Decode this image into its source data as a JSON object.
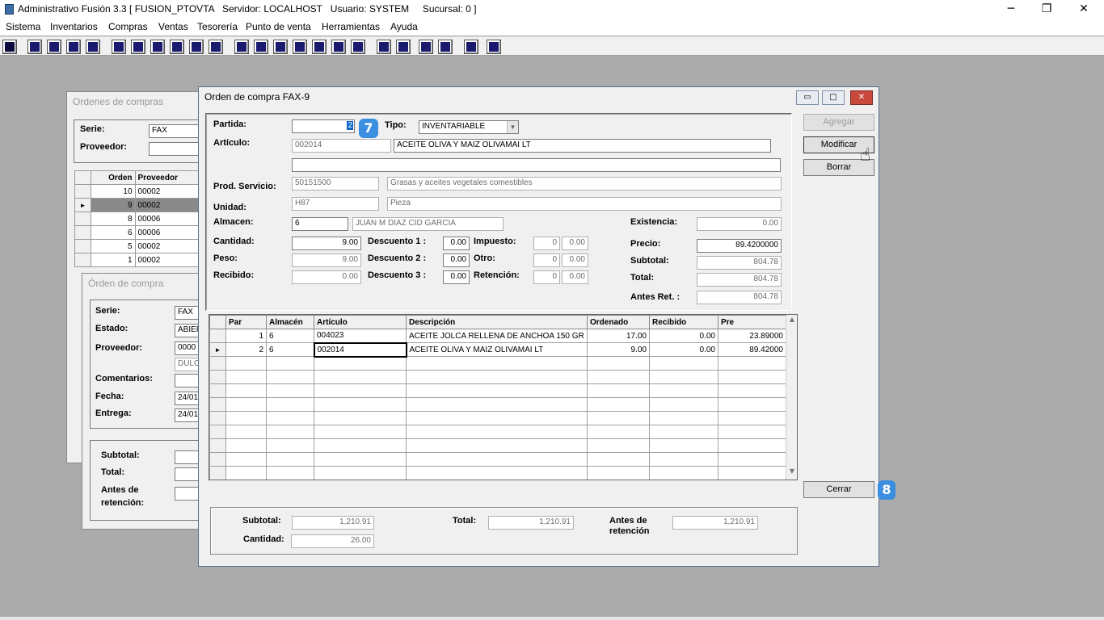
{
  "app": {
    "title": "Administrativo Fusión 3.3 [ FUSION_PTOVTA   Servidor: LOCALHOST   Usuario: SYSTEM     Sucursal: 0 ]",
    "minimize": "─",
    "restore": "❐",
    "close": "✕"
  },
  "menu": [
    "Sistema",
    "Inventarios",
    "Compras",
    "Ventas",
    "Tesorería",
    "Punto de venta",
    "Herramientas",
    "Ayuda"
  ],
  "toolbar": {
    "icons": [
      "calculator-icon",
      "copy-icon",
      "clipboard-icon",
      "swap-icon",
      "search-icon",
      "user-icon",
      "folder-icon",
      "print-icon",
      "printer-icon",
      "document-icon",
      "list-icon",
      "group-icon",
      "card-icon",
      "export-icon",
      "add-icon",
      "dollar-icon",
      "report-icon",
      "table-icon",
      "home-icon",
      "find-icon",
      "refresh-icon",
      "undo-icon",
      "back-icon",
      "help-icon"
    ]
  },
  "ordenes_window": {
    "title": "Ordenes de compras",
    "serie_label": "Serie:",
    "serie_value": "FAX",
    "proveedor_label": "Proveedor:",
    "headers": [
      "Orden",
      "Proveedor"
    ],
    "rows": [
      {
        "orden": "10",
        "prov": "00002"
      },
      {
        "orden": "9",
        "prov": "00002"
      },
      {
        "orden": "8",
        "prov": "00006"
      },
      {
        "orden": "6",
        "prov": "00006"
      },
      {
        "orden": "5",
        "prov": "00002"
      },
      {
        "orden": "1",
        "prov": "00002"
      }
    ]
  },
  "orden_window": {
    "title": "Órden de compra",
    "serie_label": "Serie:",
    "serie_value": "FAX",
    "estado_label": "Estado:",
    "estado_value": "ABIER",
    "proveedor_label": "Proveedor:",
    "proveedor_value": "0000",
    "proveedor_name": "DULC",
    "comentarios_label": "Comentarios:",
    "fecha_label": "Fecha:",
    "fecha_value": "24/01",
    "entrega_label": "Entrega:",
    "entrega_value": "24/01",
    "subtotal_label": "Subtotal:",
    "total_label": "Total:",
    "antes_label": "Antes de retención:"
  },
  "main": {
    "title": "Orden de compra FAX-9",
    "partida_label": "Partida:",
    "partida_value": "2",
    "tipo_label": "Tipo:",
    "tipo_value": "INVENTARIABLE",
    "articulo_label": "Artículo:",
    "articulo_code": "002014",
    "articulo_desc": "ACEITE OLIVA Y MAIZ OLIVAMAI LT",
    "prod_label": "Prod. Servicio:",
    "prod_code": "50151500",
    "prod_desc": "Grasas y aceites vegetales comestibles",
    "unidad_label": "Unidad:",
    "unidad_code": "H87",
    "unidad_desc": "Pieza",
    "almacen_label": "Almacen:",
    "almacen_code": "6",
    "almacen_desc": "JUAN M DIAZ CID GARCIA",
    "existencia_label": "Existencia:",
    "existencia_value": "0.00",
    "cantidad_label": "Cantidad:",
    "cantidad_value": "9.00",
    "peso_label": "Peso:",
    "peso_value": "9.00",
    "recibido_label": "Recibido:",
    "recibido_value": "0.00",
    "desc1_label": "Descuento 1 :",
    "desc1_value": "0.00",
    "desc2_label": "Descuento 2 :",
    "desc2_value": "0.00",
    "desc3_label": "Descuento 3 :",
    "desc3_value": "0.00",
    "impuesto_label": "Impuesto:",
    "impuesto_a": "0",
    "impuesto_b": "0.00",
    "otro_label": "Otro:",
    "otro_a": "0",
    "otro_b": "0.00",
    "retencion_label": "Retención:",
    "retencion_a": "0",
    "retencion_b": "0.00",
    "precio_label": "Precio:",
    "precio_value": "89.4200000",
    "subtotal_label": "Subtotal:",
    "subtotal_value": "804.78",
    "total_label": "Total:",
    "total_value": "804.78",
    "antes_label": "Antes Ret. :",
    "antes_value": "804.78",
    "btn_agregar": "Agregar",
    "btn_modificar": "Modificar",
    "btn_borrar": "Borrar",
    "btn_cerrar": "Cerrar",
    "badge7": "7",
    "badge8": "8"
  },
  "grid": {
    "headers": [
      "Par",
      "Almacén",
      "Artículo",
      "Descripción",
      "Ordenado",
      "Recibido",
      "Pre"
    ],
    "rows": [
      {
        "par": "1",
        "alm": "6",
        "art": "004023",
        "desc": "ACEITE JOLCA RELLENA DE ANCHOA 150 GR",
        "ord": "17.00",
        "rec": "0.00",
        "pre": "23.89000"
      },
      {
        "par": "2",
        "alm": "6",
        "art": "002014",
        "desc": "ACEITE OLIVA Y MAIZ OLIVAMAI LT",
        "ord": "9.00",
        "rec": "0.00",
        "pre": "89.42000"
      }
    ]
  },
  "totals": {
    "subtotal_label": "Subtotal:",
    "subtotal_value": "1,210.91",
    "cantidad_label": "Cantidad:",
    "cantidad_value": "26.00",
    "total_label": "Total:",
    "total_value": "1,210.91",
    "antes_label": "Antes de retención",
    "antes_value": "1,210.91"
  }
}
